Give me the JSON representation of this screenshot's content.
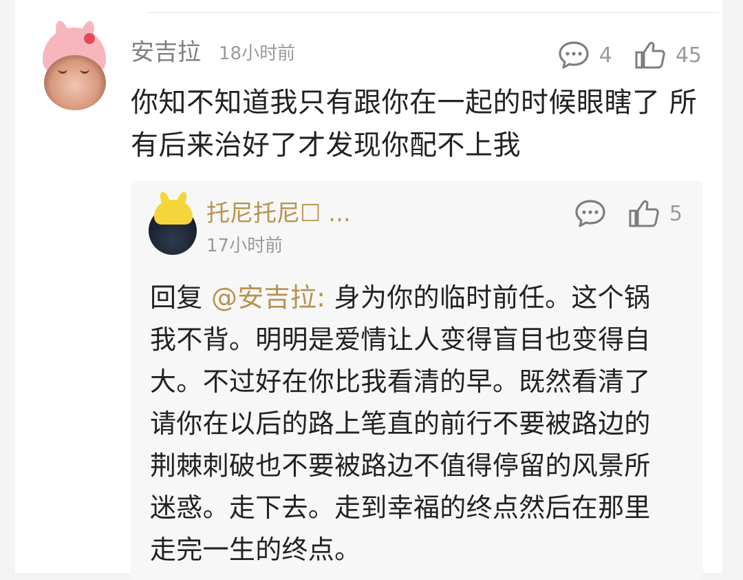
{
  "comment": {
    "username": "安吉拉",
    "timestamp": "18小时前",
    "reply_count": "4",
    "like_count": "45",
    "text": "你知不知道我只有跟你在一起的时候眼瞎了 所有后来治好了才发现你配不上我"
  },
  "reply": {
    "username": "托尼托尼☐ ...",
    "timestamp": "17小时前",
    "like_count": "5",
    "prefix": "回复 ",
    "mention": "@安吉拉:",
    "text": " 身为你的临时前任。这个锅我不背。明明是爱情让人变得盲目也变得自大。不过好在你比我看清的早。既然看清了请你在以后的路上笔直的前行不要被路边的荆棘刺破也不要被路边不值得停留的风景所迷惑。走下去。走到幸福的终点然后在那里走完一生的终点。"
  },
  "colors": {
    "accent_username": "#b9924f",
    "muted": "#9a9a9a"
  },
  "icons": {
    "comment_icon": "speech-bubble-icon",
    "like_icon": "thumbs-up-icon"
  }
}
